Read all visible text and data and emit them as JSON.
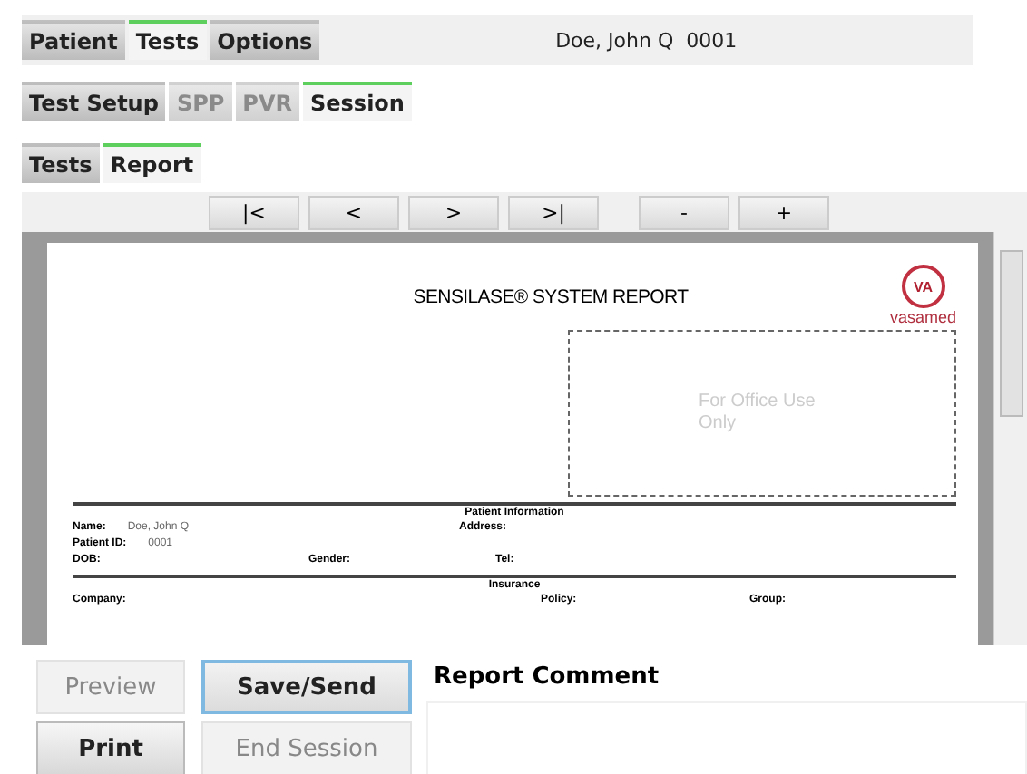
{
  "main_tabs": [
    {
      "label": "Patient",
      "selected": false
    },
    {
      "label": "Tests",
      "selected": true
    },
    {
      "label": "Options",
      "selected": false
    }
  ],
  "patient_banner": "Doe, John Q  0001",
  "session_tabs": [
    {
      "label": "Test Setup",
      "selected": false,
      "disabled": false
    },
    {
      "label": "SPP",
      "selected": false,
      "disabled": true
    },
    {
      "label": "PVR",
      "selected": false,
      "disabled": true
    },
    {
      "label": "Session",
      "selected": true,
      "disabled": false
    }
  ],
  "view_tabs": [
    {
      "label": "Tests",
      "selected": false
    },
    {
      "label": "Report",
      "selected": true
    }
  ],
  "nav_buttons": [
    "|<",
    "<",
    ">",
    ">|"
  ],
  "zoom_buttons": [
    "-",
    "+"
  ],
  "report": {
    "title": "SENSILASE® SYSTEM REPORT",
    "logo_mark": "VA",
    "logo_text": "vasamed",
    "office_box": "For Office Use Only",
    "sections": [
      {
        "heading": "Patient Information",
        "rows": [
          [
            {
              "label": "Name:",
              "value": "Doe, John Q"
            },
            {
              "label": "Address:"
            }
          ],
          [
            {
              "label": "Patient ID:",
              "value": "0001"
            }
          ],
          [
            {
              "label": "DOB:"
            },
            {
              "label": "Gender:"
            },
            {
              "label": "Tel:"
            }
          ]
        ]
      },
      {
        "heading": "Insurance",
        "rows": [
          [
            {
              "label": "Company:"
            },
            {
              "label": "Policy:"
            },
            {
              "label": "Group:"
            }
          ]
        ]
      }
    ]
  },
  "actions": [
    {
      "label": "Preview",
      "disabled": true,
      "focused": false
    },
    {
      "label": "Save/Send",
      "disabled": false,
      "focused": true
    },
    {
      "label": "Print",
      "disabled": false,
      "focused": false
    },
    {
      "label": "End Session",
      "disabled": true,
      "focused": false
    }
  ],
  "comment": {
    "label": "Report Comment"
  }
}
